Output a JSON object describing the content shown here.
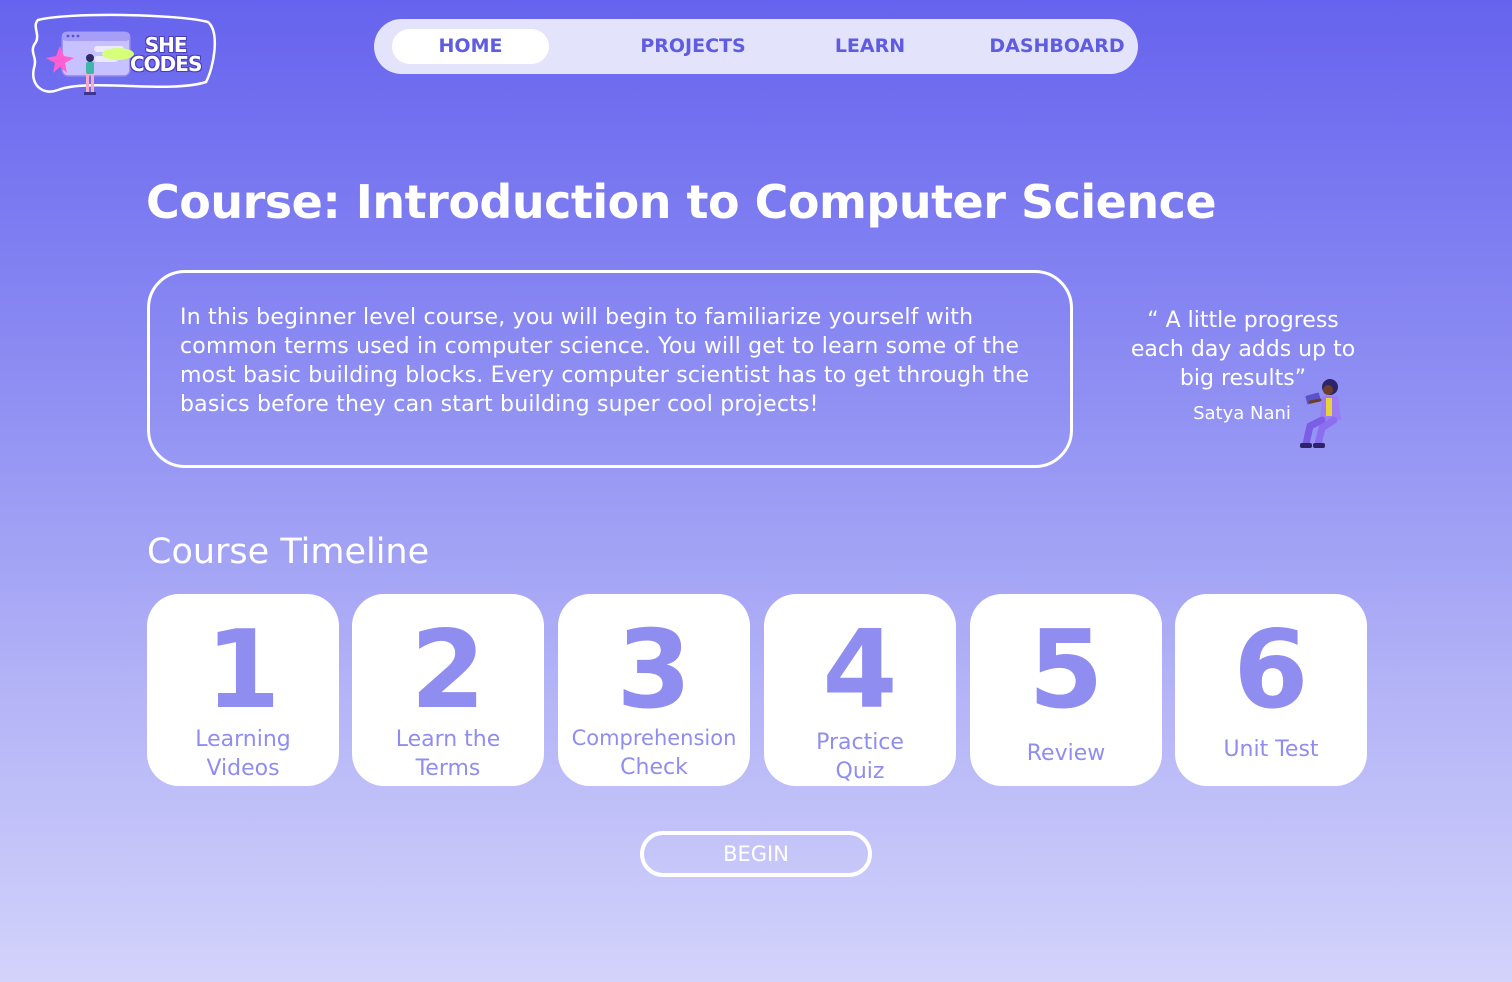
{
  "brand": {
    "line1": "SHE",
    "line2": "CODES",
    "colors": {
      "outline": "#ffffff",
      "window": "#c7c2ff",
      "star": "#ff5fd2",
      "highlight": "#d6ff7a"
    }
  },
  "nav": {
    "items": [
      {
        "label": "HOME",
        "active": true
      },
      {
        "label": "PROJECTS",
        "active": false
      },
      {
        "label": "LEARN",
        "active": false
      },
      {
        "label": "DASHBOARD",
        "active": false
      }
    ]
  },
  "page": {
    "title": "Course: Introduction to Computer Science",
    "description": "In this beginner level course, you will begin to familiarize yourself with common terms used in computer science. You will get to learn some of the most basic building blocks. Every computer scientist has to get through the basics before they can start building super cool projects!"
  },
  "quote": {
    "text": "“ A little progress each day adds up to big results”",
    "author": "Satya Nani",
    "illustration": "person-with-laptop-icon"
  },
  "timeline": {
    "title": "Course Timeline",
    "steps": [
      {
        "number": "1",
        "label_line1": "Learning",
        "label_line2": "Videos"
      },
      {
        "number": "2",
        "label_line1": "Learn the",
        "label_line2": "Terms"
      },
      {
        "number": "3",
        "label_line1": "Comprehension",
        "label_line2": "Check"
      },
      {
        "number": "4",
        "label_line1": "Practice",
        "label_line2": "Quiz"
      },
      {
        "number": "5",
        "label_line1": "Review",
        "label_line2": ""
      },
      {
        "number": "6",
        "label_line1": "Unit Test",
        "label_line2": ""
      }
    ]
  },
  "actions": {
    "begin_label": "BEGIN"
  },
  "theme": {
    "accent": "#8f8df0",
    "nav_text": "#5f5ce2",
    "gradient_top": "#6663ee",
    "gradient_bottom": "#d3d3fb"
  }
}
